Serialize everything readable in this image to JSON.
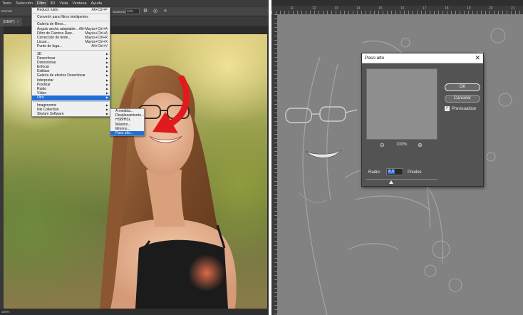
{
  "left_panel": {
    "menubar": [
      "Texto",
      "Selección",
      "Filtro",
      "3D",
      "Vista",
      "Ventana",
      "Ayuda"
    ],
    "active_menu_index": 2,
    "options": {
      "mode": "Normal",
      "smoothing_label": "Suavizar:",
      "smoothing_value": "10%"
    },
    "document_tab": "(GB/8*)",
    "status": "100%"
  },
  "filter_menu": {
    "groups": [
      [
        {
          "label": "Reducir ruido",
          "shortcut": "Alt+Ctrl+F"
        }
      ],
      [
        {
          "label": "Convertir para filtros inteligentes"
        }
      ],
      [
        {
          "label": "Galería de filtros..."
        },
        {
          "label": "Ángulo ancho adaptable...",
          "shortcut": "Alt+Mayús+Ctrl+A"
        },
        {
          "label": "Filtro de Camera Raw...",
          "shortcut": "Mayús+Ctrl+A"
        },
        {
          "label": "Corrección de lente...",
          "shortcut": "Mayús+Ctrl+R"
        },
        {
          "label": "Licuar...",
          "shortcut": "Mayús+Ctrl+X"
        },
        {
          "label": "Punto de fuga...",
          "shortcut": "Alt+Ctrl+V"
        }
      ],
      [
        {
          "label": "3D",
          "submenu": true
        },
        {
          "label": "Desenfocar",
          "submenu": true
        },
        {
          "label": "Distorsionar",
          "submenu": true
        },
        {
          "label": "Enfocar",
          "submenu": true
        },
        {
          "label": "Estilizar",
          "submenu": true
        },
        {
          "label": "Galería de efectos Desenfocar",
          "submenu": true
        },
        {
          "label": "Interpretar",
          "submenu": true
        },
        {
          "label": "Pixelizar",
          "submenu": true
        },
        {
          "label": "Ruido",
          "submenu": true
        },
        {
          "label": "Vídeo",
          "submenu": true
        },
        {
          "label": "Otro",
          "submenu": true,
          "highlighted": true
        }
      ],
      [
        {
          "label": "Imagenomic",
          "submenu": true
        },
        {
          "label": "Nik Collection",
          "submenu": true
        },
        {
          "label": "Skylum Software",
          "submenu": true
        }
      ]
    ]
  },
  "otro_submenu": {
    "items": [
      {
        "label": "A medida..."
      },
      {
        "label": "Desplazamiento..."
      },
      {
        "label": "HSB/HSL"
      },
      {
        "label": "Máximo..."
      },
      {
        "label": "Mínimo..."
      },
      {
        "label": "Paso alto...",
        "highlighted": true
      }
    ]
  },
  "right_panel": {
    "ruler_numbers": [
      "11",
      "12",
      "13",
      "14",
      "15",
      "16",
      "17",
      "18",
      "19",
      "20",
      "21"
    ]
  },
  "dialog": {
    "title": "Paso alto",
    "ok_label": "OK",
    "cancel_label": "Cancelar",
    "preview_label": "Previsualizar",
    "preview_checked": true,
    "zoom_value": "100%",
    "radius_label": "Radio:",
    "radius_value": "8,0",
    "radius_unit": "Píxeles",
    "slider_fraction": 0.35
  },
  "colors": {
    "menu_highlight": "#1f6fd6",
    "arrow": "#e01b1b",
    "dialog_bg": "#535353"
  }
}
